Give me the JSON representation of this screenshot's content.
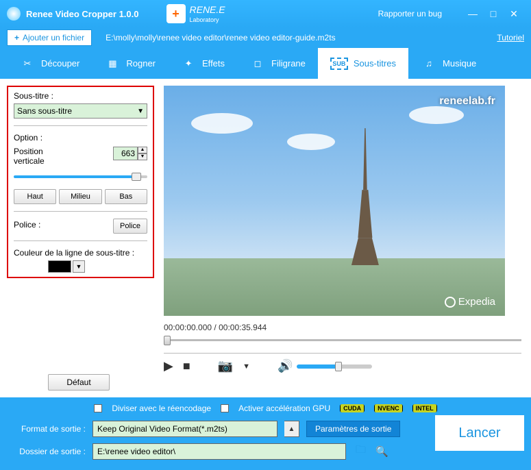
{
  "titlebar": {
    "title": "Renee Video Cropper 1.0.0",
    "brand": "RENE.E",
    "brand_sub": "Laboratory",
    "bug": "Rapporter un bug"
  },
  "toolbar": {
    "add_file": "Ajouter un fichier",
    "path": "E:\\molly\\molly\\renee video editor\\renee video editor-guide.m2ts",
    "tutorial": "Tutoriel"
  },
  "tabs": {
    "cut": "Découper",
    "crop": "Rogner",
    "effects": "Effets",
    "watermark": "Filigrane",
    "subtitles": "Sous-titres",
    "music": "Musique"
  },
  "panel": {
    "subtitle_label": "Sous-titre :",
    "subtitle_value": "Sans sous-titre",
    "option_label": "Option :",
    "position_label": "Position verticale",
    "position_value": "663",
    "btn_top": "Haut",
    "btn_mid": "Milieu",
    "btn_bot": "Bas",
    "font_label": "Police :",
    "font_btn": "Police",
    "color_label": "Couleur de la ligne de sous-titre :",
    "default_btn": "Défaut"
  },
  "preview": {
    "site": "reneelab.fr",
    "brand": "Expedia",
    "time_current": "00:00:00.000",
    "time_total": "00:00:35.944"
  },
  "bottom": {
    "divide": "Diviser avec le réencodage",
    "gpu": "Activer accélération GPU",
    "badge1": "CUDA",
    "badge2": "NVENC",
    "badge3": "INTEL",
    "format_label": "Format de sortie :",
    "format_value": "Keep Original Video Format(*.m2ts)",
    "params": "Paramètres de sortie",
    "folder_label": "Dossier de sortie :",
    "folder_value": "E:\\renee video editor\\",
    "launch": "Lancer"
  }
}
